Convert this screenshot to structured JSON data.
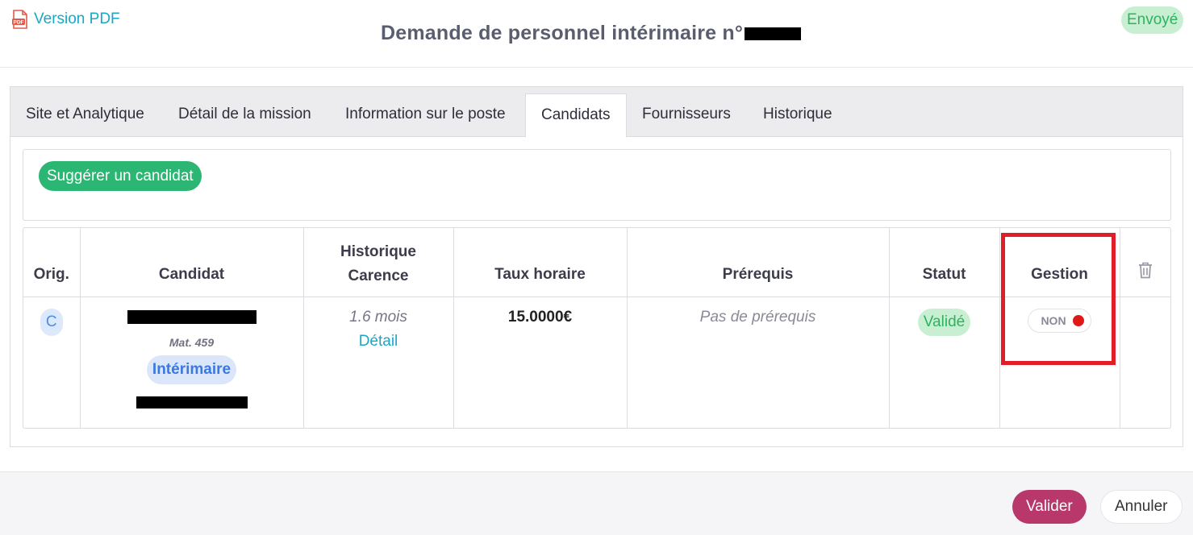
{
  "header": {
    "pdf_link_label": "Version PDF",
    "title_prefix": "Demande de personnel intérimaire n°",
    "status_label": "Envoyé"
  },
  "tabs": [
    {
      "label": "Site et Analytique"
    },
    {
      "label": "Détail de la mission"
    },
    {
      "label": "Information sur le poste"
    },
    {
      "label": "Candidats"
    },
    {
      "label": "Fournisseurs"
    },
    {
      "label": "Historique"
    }
  ],
  "active_tab": "Candidats",
  "suggest_button_label": "Suggérer un candidat",
  "table": {
    "headers": {
      "orig": "Orig.",
      "candidat": "Candidat",
      "historique_1": "Historique",
      "historique_2": "Carence",
      "taux": "Taux horaire",
      "prerequis": "Prérequis",
      "statut": "Statut",
      "gestion": "Gestion"
    },
    "row": {
      "orig": "C",
      "mat": "Mat. 459",
      "type_badge": "Intérimaire",
      "historique_value": "1.6 mois",
      "historique_link": "Détail",
      "taux": "15.0000€",
      "prerequis": "Pas de prérequis",
      "statut": "Validé",
      "gestion_toggle": "NON"
    }
  },
  "footer": {
    "valider_label": "Valider",
    "annuler_label": "Annuler"
  },
  "icons": {
    "pdf": "pdf-file-icon",
    "trash": "trash-icon"
  },
  "colors": {
    "link": "#17a8c6",
    "success_bg": "#c9efd2",
    "success_text": "#2fb260",
    "suggest_bg": "#2bb673",
    "primary": "#b8386b",
    "toggle_off": "#e01818",
    "highlight": "#e11d28"
  }
}
